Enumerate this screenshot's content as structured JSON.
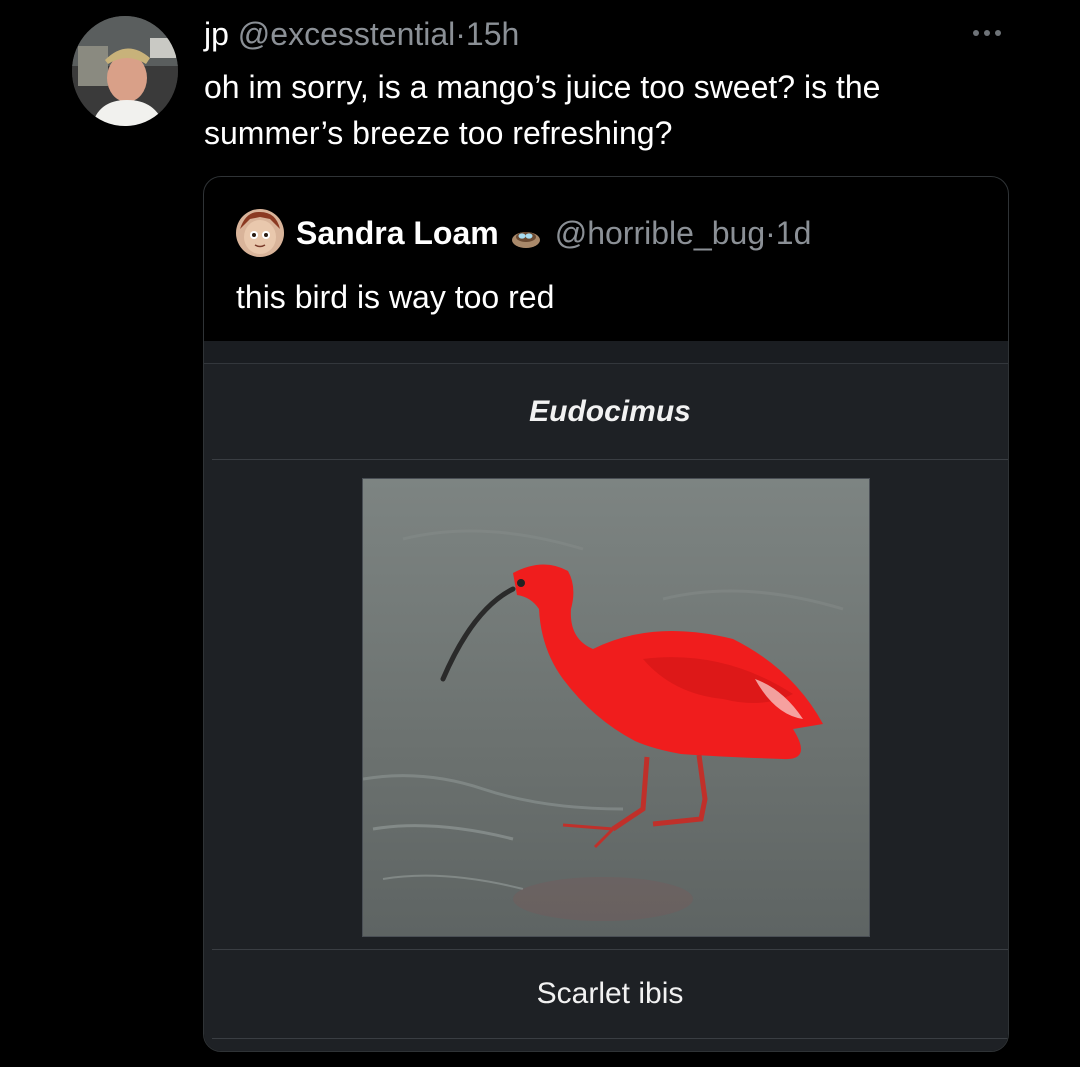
{
  "tweet": {
    "name": "jp",
    "handle": "@excesstential",
    "separator": "·",
    "time": "15h",
    "text": "oh im sorry, is a mango’s juice too sweet? is the summer’s breeze too refreshing?",
    "more_icon": "more-dots-icon",
    "avatar_icon": "user-avatar"
  },
  "quote": {
    "name": "Sandra Loam",
    "badge_icon": "bird-nest-icon",
    "handle": "@horrible_bug",
    "separator": "·",
    "time": "1d",
    "text": "this bird is way too red",
    "avatar_icon": "cartoon-avatar",
    "embed": {
      "title": "Eudocimus",
      "image_icon": "scarlet-ibis-photo",
      "caption": "Scarlet ibis"
    }
  },
  "colors": {
    "background": "#000000",
    "secondary_text": "#8b9096",
    "border": "#2f3336",
    "embed_bg": "#1e2125",
    "ibis_red": "#f01d1d"
  }
}
